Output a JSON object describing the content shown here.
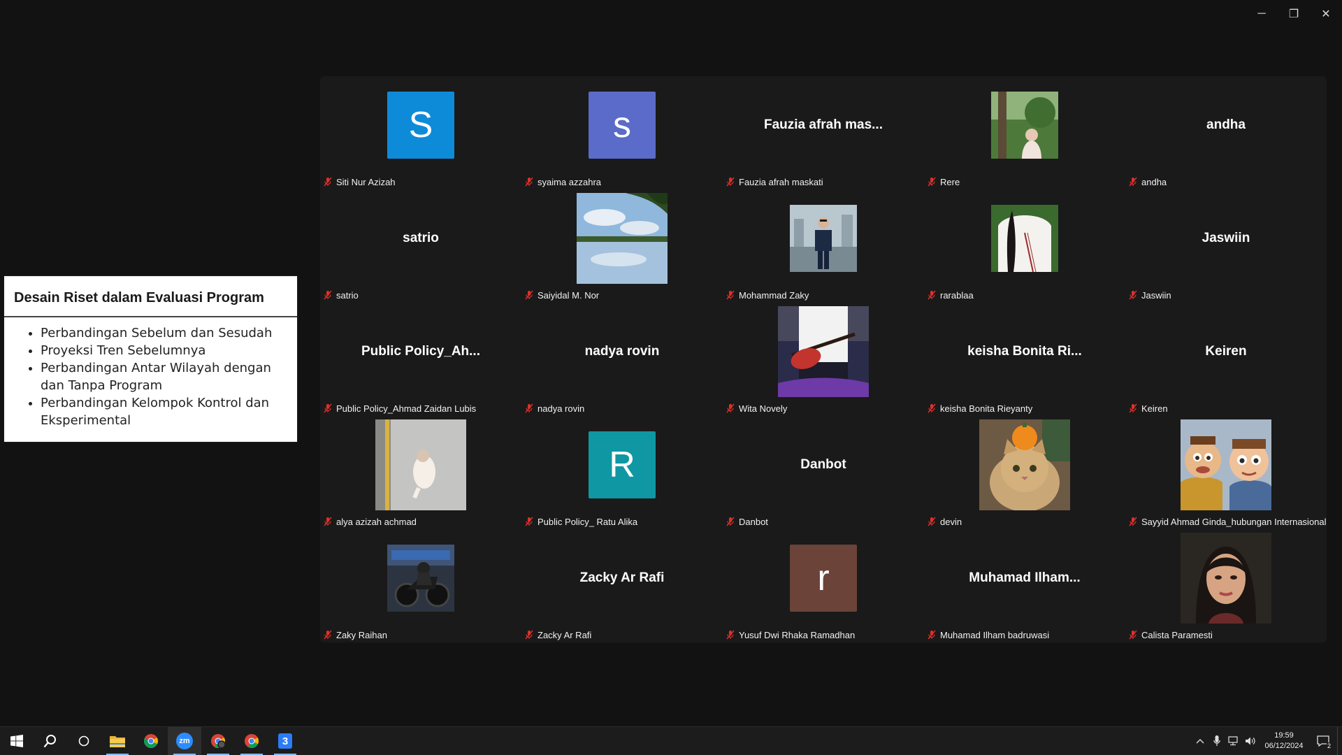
{
  "window": {
    "minimize_icon": "minimize-icon",
    "restore_icon": "restore-icon",
    "close_icon": "close-icon",
    "minimize_glyph": "─",
    "restore_glyph": "❐",
    "close_glyph": "✕"
  },
  "slide": {
    "title": "Desain Riset dalam Evaluasi Program",
    "bullets": [
      "Perbandingan Sebelum dan Sesudah",
      "Proyeksi Tren Sebelumnya",
      "Perbandingan Antar Wilayah dengan dan Tanpa Program",
      "Perbandingan Kelompok Kontrol dan Eksperimental"
    ]
  },
  "participants": [
    {
      "type": "letter",
      "letter": "S",
      "color": "#0e8bd8",
      "name": "Siti Nur Azizah"
    },
    {
      "type": "letter",
      "letter": "s",
      "color": "#5b6bc9",
      "name": "syaima azzahra"
    },
    {
      "type": "text",
      "display": "Fauzia afrah mas...",
      "name": "Fauzia afrah maskati"
    },
    {
      "type": "photo",
      "icon": "woman-in-garden-photo",
      "name": "Rere"
    },
    {
      "type": "text",
      "display": "andha",
      "name": "andha"
    },
    {
      "type": "text",
      "display": "satrio",
      "name": "satrio"
    },
    {
      "type": "photo",
      "icon": "lake-and-sky-photo",
      "name": "Saiyidal M. Nor"
    },
    {
      "type": "photo",
      "icon": "man-standing-photo",
      "name": "Mohammad Zaky"
    },
    {
      "type": "photo",
      "icon": "white-shirt-photo",
      "name": "rarablaa"
    },
    {
      "type": "text",
      "display": "Jaswiin",
      "name": "Jaswiin"
    },
    {
      "type": "text",
      "display": "Public  Policy_Ah...",
      "name": "Public Policy_Ahmad Zaidan Lubis"
    },
    {
      "type": "text",
      "display": "nadya rovin",
      "name": "nadya rovin"
    },
    {
      "type": "photo",
      "icon": "guitar-player-photo",
      "name": "Wita Novely"
    },
    {
      "type": "text",
      "display": "keisha Bonita Ri...",
      "name": "keisha Bonita Rieyanty"
    },
    {
      "type": "text",
      "display": "Keiren",
      "name": "Keiren"
    },
    {
      "type": "photo",
      "icon": "cat-in-elevator-photo",
      "name": "alya azizah achmad"
    },
    {
      "type": "letter",
      "letter": "R",
      "color": "#0f98a3",
      "name": "Public Policy_ Ratu Alika"
    },
    {
      "type": "text",
      "display": "Danbot",
      "name": "Danbot"
    },
    {
      "type": "photo",
      "icon": "cat-with-orange-photo",
      "name": "devin"
    },
    {
      "type": "photo",
      "icon": "toy-figures-photo",
      "name": "Sayyid Ahmad Ginda_hubungan Internasional"
    },
    {
      "type": "photo",
      "icon": "motorcycle-photo",
      "name": "Zaky Raihan"
    },
    {
      "type": "text",
      "display": "Zacky Ar Rafi",
      "name": "Zacky Ar Rafi"
    },
    {
      "type": "letter",
      "letter": "r",
      "color": "#6b4339",
      "name": "Yusuf Dwi Rhaka Ramadhan"
    },
    {
      "type": "text",
      "display": "Muhamad  Ilham...",
      "name": "Muhamad Ilham badruwasi"
    },
    {
      "type": "photo",
      "icon": "woman-portrait-photo",
      "name": "Calista Paramesti"
    }
  ],
  "taskbar": {
    "apps": [
      {
        "icon": "windows-start-icon"
      },
      {
        "icon": "search-icon"
      },
      {
        "icon": "task-view-icon"
      },
      {
        "icon": "file-explorer-icon"
      },
      {
        "icon": "chrome-icon"
      },
      {
        "icon": "zoom-icon",
        "label": "zm"
      },
      {
        "icon": "chrome-profile-icon"
      },
      {
        "icon": "chrome-icon"
      },
      {
        "icon": "app-3-icon",
        "label": "3"
      }
    ],
    "time": "19:59",
    "date": "06/12/2024",
    "notification_count": "2"
  }
}
